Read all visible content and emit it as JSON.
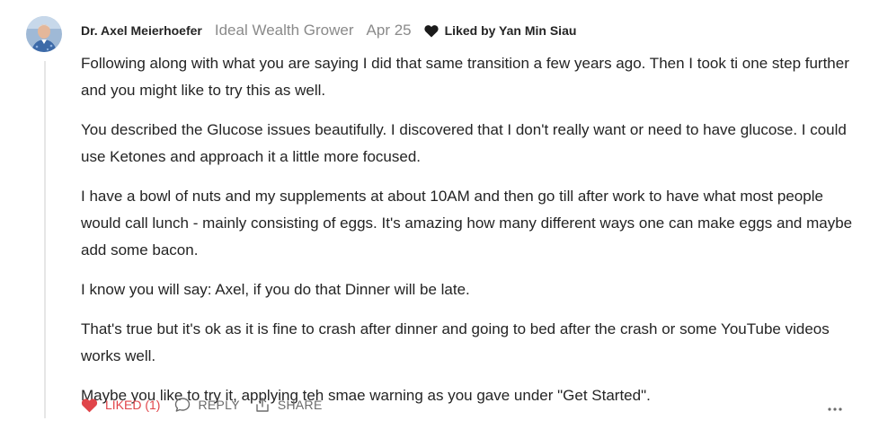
{
  "comment": {
    "author": "Dr. Axel Meierhoefer",
    "publication": "Ideal Wealth Grower",
    "date": "Apr 25",
    "liked_by": "Liked by Yan Min Siau",
    "paragraphs": [
      "Following along with what you are saying I did that same transition a few years ago. Then I took ti one step further and you might like to try this as well.",
      "You described the Glucose issues beautifully. I discovered that I don't really want or need to have glucose. I could use Ketones and approach it a little more focused.",
      "I have a bowl of nuts and my supplements at about 10AM and then go till after work to have what most people would call lunch - mainly consisting of eggs. It's amazing how many different ways one can make eggs and maybe add some bacon.",
      "I know you will say: Axel, if you do that Dinner will be late.",
      "That's true but it's ok as it is fine to crash after dinner and going to bed after the crash or some YouTube videos works well.",
      "Maybe you like to try it, applying teh smae warning as you gave under \"Get Started\"."
    ]
  },
  "actions": {
    "like_label": "LIKED (1)",
    "reply_label": "REPLY",
    "share_label": "SHARE"
  },
  "icons": {
    "avatar": "avatar-photo",
    "liked_by": "heart-icon",
    "like": "heart-filled-icon",
    "reply": "speech-bubble-icon",
    "share": "share-upload-icon",
    "more": "ellipsis-icon"
  },
  "colors": {
    "like_accent": "#e0454a",
    "muted_text": "#8a8a8a",
    "body_text": "#242424"
  }
}
